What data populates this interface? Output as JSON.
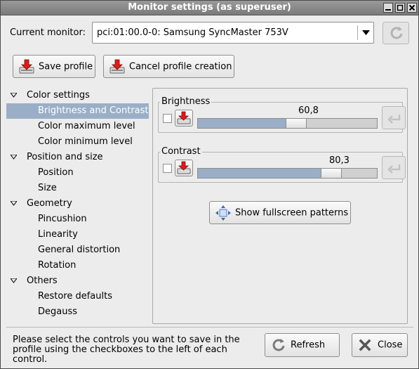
{
  "window": {
    "title": "Monitor settings (as superuser)"
  },
  "monitor": {
    "label": "Current monitor:",
    "selected": "pci:01:00.0-0: Samsung SyncMaster 753V"
  },
  "toolbar": {
    "save_profile": "Save profile",
    "cancel_profile": "Cancel profile creation"
  },
  "tree": {
    "groups": [
      {
        "label": "Color settings",
        "children": [
          "Brightness and Contrast",
          "Color maximum level",
          "Color minimum level"
        ]
      },
      {
        "label": "Position and size",
        "children": [
          "Position",
          "Size"
        ]
      },
      {
        "label": "Geometry",
        "children": [
          "Pincushion",
          "Linearity",
          "General distortion",
          "Rotation"
        ]
      },
      {
        "label": "Others",
        "children": [
          "Restore defaults",
          "Degauss"
        ]
      }
    ],
    "selected": "Brightness and Contrast"
  },
  "controls": {
    "brightness": {
      "label": "Brightness",
      "value_text": "60,8",
      "fraction": 0.608,
      "checked": false
    },
    "contrast": {
      "label": "Contrast",
      "value_text": "80,3",
      "fraction": 0.803,
      "checked": false
    },
    "fullscreen_button": "Show fullscreen patterns"
  },
  "footer": {
    "help_text": "Please select the controls you want to save in the profile using the checkboxes to the left of each control.",
    "refresh": "Refresh",
    "close": "Close"
  },
  "colors": {
    "selection": "#9aafc7",
    "slider_fill": "#9aafc7",
    "title_bar": "#8a8a8a"
  },
  "icons": [
    "save-profile-icon",
    "revert-icon",
    "refresh-icon",
    "close-icon",
    "fullscreen-icon"
  ]
}
